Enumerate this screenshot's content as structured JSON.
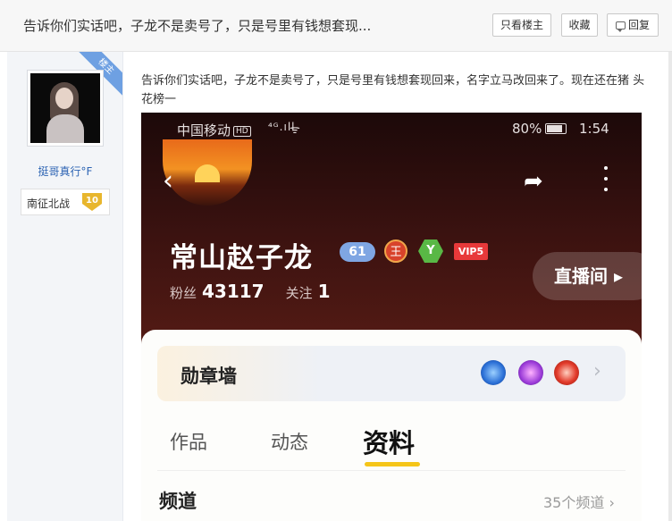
{
  "thread": {
    "title": "告诉你们实话吧，子龙不是卖号了，只是号里有钱想套现...",
    "buttons": {
      "only_op": "只看楼主",
      "favorite": "收藏",
      "reply": "回复"
    }
  },
  "author": {
    "ribbon": "楼主",
    "username": "挺哥真行°F",
    "forum_badge": {
      "forum_name": "南征北战",
      "level": "10"
    }
  },
  "post": {
    "text": "告诉你们实话吧，子龙不是卖号了，只是号里有钱想套现回来，名字立马改回来了。现在还在猪 头 花榜一"
  },
  "phone": {
    "status": {
      "carrier": "中国移动",
      "hd": "HD",
      "network": "⁴ᴳ.ıll",
      "battery": "80%",
      "time": "1:54"
    },
    "profile": {
      "nickname": "常山赵子龙",
      "level_badge": "61",
      "wang_badge": "王",
      "y_badge": "Y",
      "vip_badge": "VIP5",
      "fans_label": "粉丝",
      "fans_count": "43117",
      "following_label": "关注",
      "following_count": "1",
      "live_button": "直播间 ▸"
    },
    "panel": {
      "medal_wall": "勋章墙",
      "tabs": [
        "作品",
        "动态",
        "资料"
      ],
      "active_tab": "资料",
      "channel_label": "频道",
      "channel_count": "35个频道 ›"
    }
  },
  "icons": {
    "back": "chevron-left",
    "share": "share-arrow",
    "more": "vertical-ellipsis",
    "reply": "speech-bubble",
    "wifi": "wifi"
  },
  "colors": {
    "link_blue": "#2d64b3",
    "ribbon_blue": "#6ea0e2",
    "tab_underline": "#f5c518",
    "vip_red": "#e8393a"
  }
}
